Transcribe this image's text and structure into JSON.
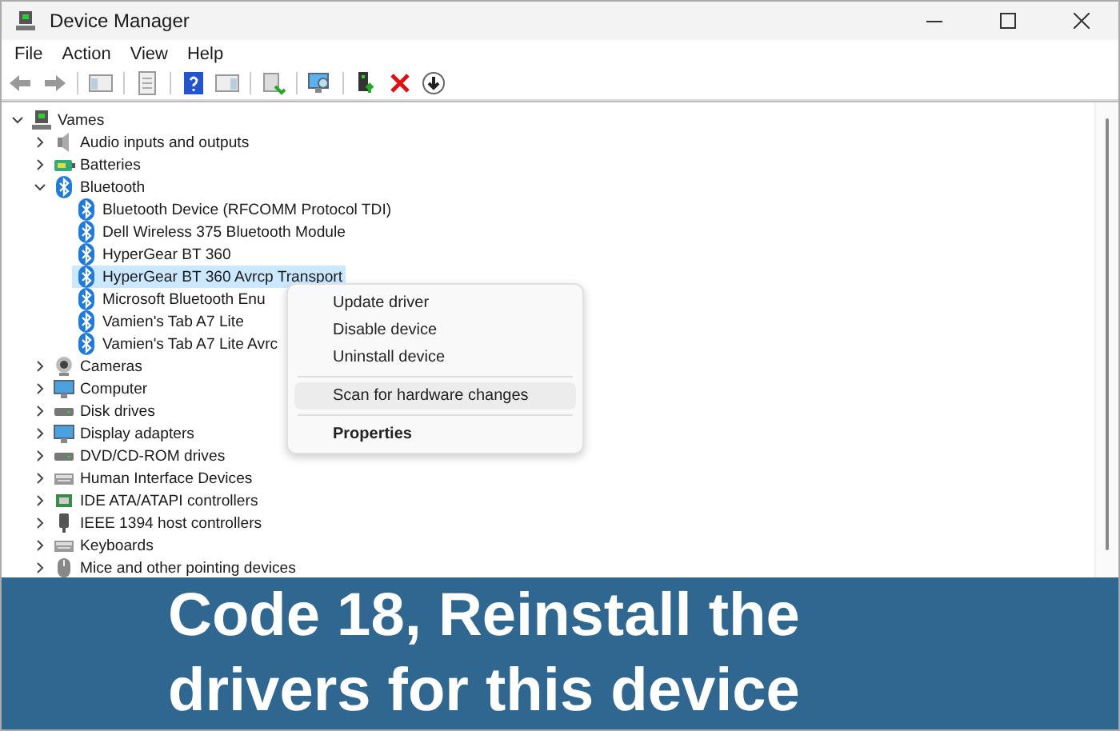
{
  "window": {
    "title": "Device Manager"
  },
  "menu_bar": [
    "File",
    "Action",
    "View",
    "Help"
  ],
  "tree": [
    {
      "label": "Vames",
      "kind": "computer",
      "expanded": true,
      "selected": false,
      "children": [
        {
          "label": "Audio inputs and outputs",
          "kind": "speaker",
          "expanded": false,
          "selected": false
        },
        {
          "label": "Batteries",
          "kind": "battery",
          "expanded": false,
          "selected": false
        },
        {
          "label": "Bluetooth",
          "kind": "bluetooth",
          "expanded": true,
          "selected": false,
          "children": [
            {
              "label": "Bluetooth Device (RFCOMM Protocol TDI)",
              "kind": "bluetooth",
              "selected": false
            },
            {
              "label": "Dell Wireless 375 Bluetooth Module",
              "kind": "bluetooth",
              "selected": false
            },
            {
              "label": "HyperGear BT 360",
              "kind": "bluetooth",
              "selected": false
            },
            {
              "label": "HyperGear BT 360 Avrcp Transport",
              "kind": "bluetooth",
              "selected": true
            },
            {
              "label": "Microsoft Bluetooth Enu",
              "kind": "bluetooth",
              "selected": false
            },
            {
              "label": "Vamien's Tab A7 Lite",
              "kind": "bluetooth",
              "selected": false
            },
            {
              "label": "Vamien's Tab A7 Lite Avrc",
              "kind": "bluetooth",
              "selected": false
            }
          ]
        },
        {
          "label": "Cameras",
          "kind": "camera",
          "expanded": false,
          "selected": false
        },
        {
          "label": "Computer",
          "kind": "monitor",
          "expanded": false,
          "selected": false
        },
        {
          "label": "Disk drives",
          "kind": "drive",
          "expanded": false,
          "selected": false
        },
        {
          "label": "Display adapters",
          "kind": "monitor",
          "expanded": false,
          "selected": false
        },
        {
          "label": "DVD/CD-ROM drives",
          "kind": "drive",
          "expanded": false,
          "selected": false
        },
        {
          "label": "Human Interface Devices",
          "kind": "keyboard",
          "expanded": false,
          "selected": false
        },
        {
          "label": "IDE ATA/ATAPI controllers",
          "kind": "chip",
          "expanded": false,
          "selected": false
        },
        {
          "label": "IEEE 1394 host controllers",
          "kind": "plug",
          "expanded": false,
          "selected": false
        },
        {
          "label": "Keyboards",
          "kind": "keyboard",
          "expanded": false,
          "selected": false
        },
        {
          "label": "Mice and other pointing devices",
          "kind": "mouse",
          "expanded": false,
          "selected": false
        }
      ]
    }
  ],
  "context_menu": [
    {
      "label": "Update driver",
      "selected": false,
      "default": false,
      "separator_before": false
    },
    {
      "label": "Disable device",
      "selected": false,
      "default": false,
      "separator_before": false
    },
    {
      "label": "Uninstall device",
      "selected": false,
      "default": false,
      "separator_before": false
    },
    {
      "label": "Scan for hardware changes",
      "selected": true,
      "default": false,
      "separator_before": true
    },
    {
      "label": "Properties",
      "selected": false,
      "default": true,
      "separator_before": true
    }
  ],
  "banner": {
    "lines": [
      "Code 18, Reinstall the",
      "drivers for this device"
    ]
  }
}
